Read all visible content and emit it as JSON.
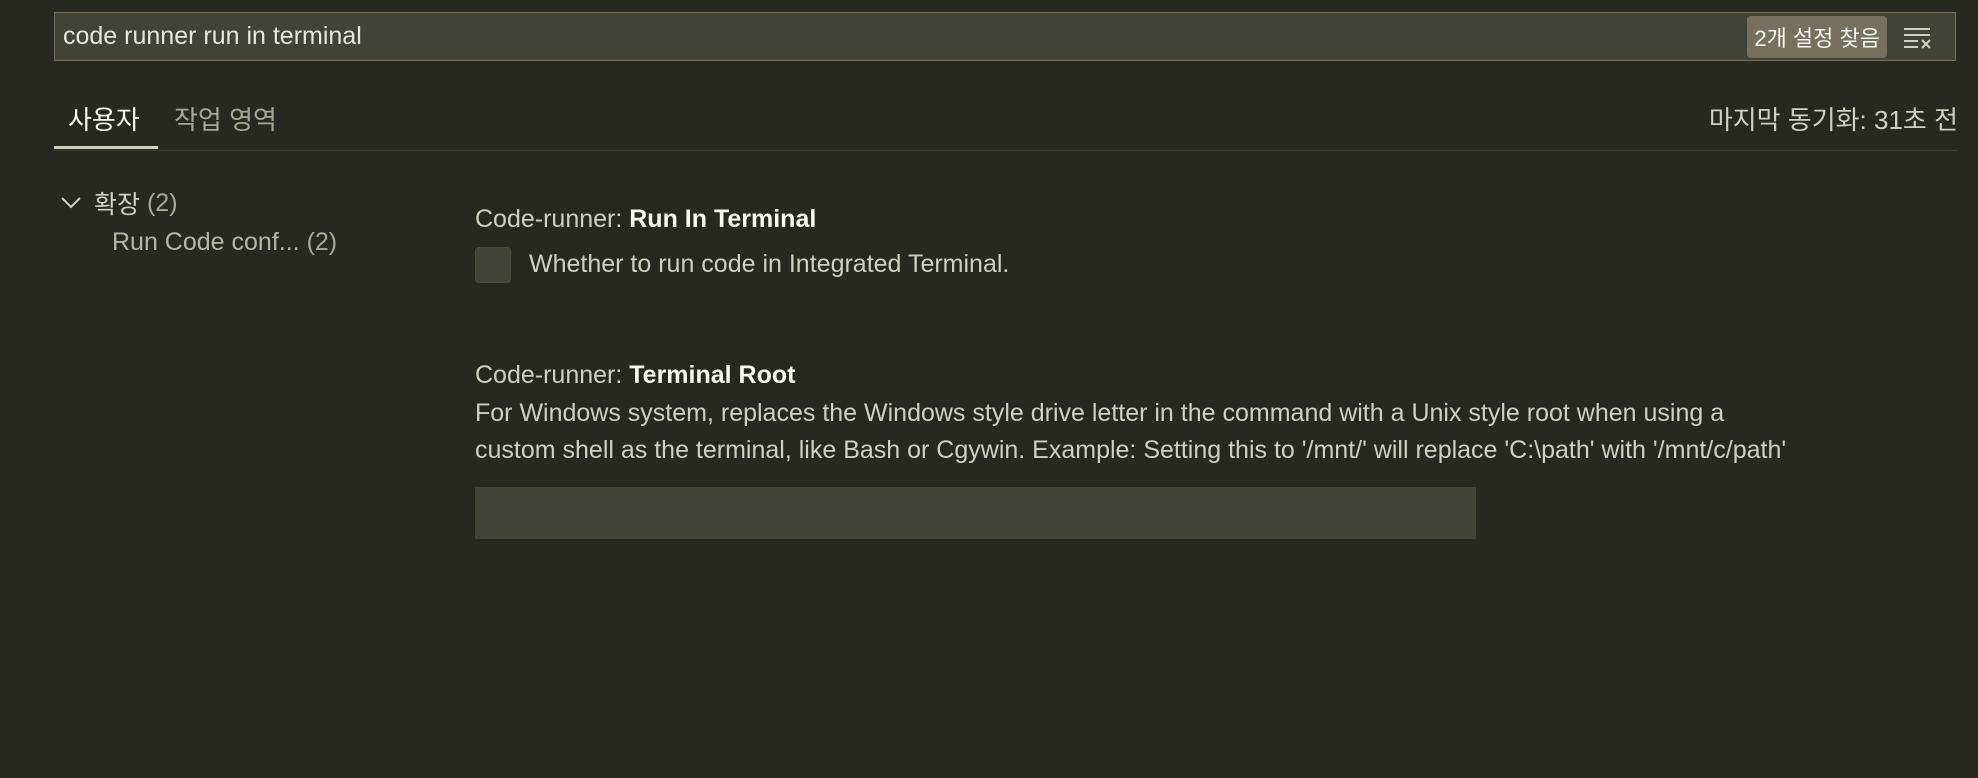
{
  "search": {
    "value": "code runner run in terminal",
    "result_count": "2개 설정 찾음",
    "clear_icon": "clear-filter-icon"
  },
  "tabs": [
    {
      "label": "사용자",
      "active": true
    },
    {
      "label": "작업 영역",
      "active": false
    }
  ],
  "sync_status": "마지막 동기화: 31초 전",
  "toc": {
    "group_label": "확장",
    "group_count": "(2)",
    "item_label": "Run Code conf...",
    "item_count": "(2)"
  },
  "settings": [
    {
      "prefix": "Code-runner: ",
      "name": "Run In Terminal",
      "description": "Whether to run code in Integrated Terminal.",
      "checked": false
    },
    {
      "prefix": "Code-runner: ",
      "name": "Terminal Root",
      "description_line1": "For Windows system, replaces the Windows style drive letter in the command with a Unix style root when using a",
      "description_line2": "custom shell as the terminal, like Bash or Cgywin. Example: Setting this to '/mnt/' will replace 'C:\\path' with '/mnt/c/path'",
      "value": ""
    }
  ]
}
